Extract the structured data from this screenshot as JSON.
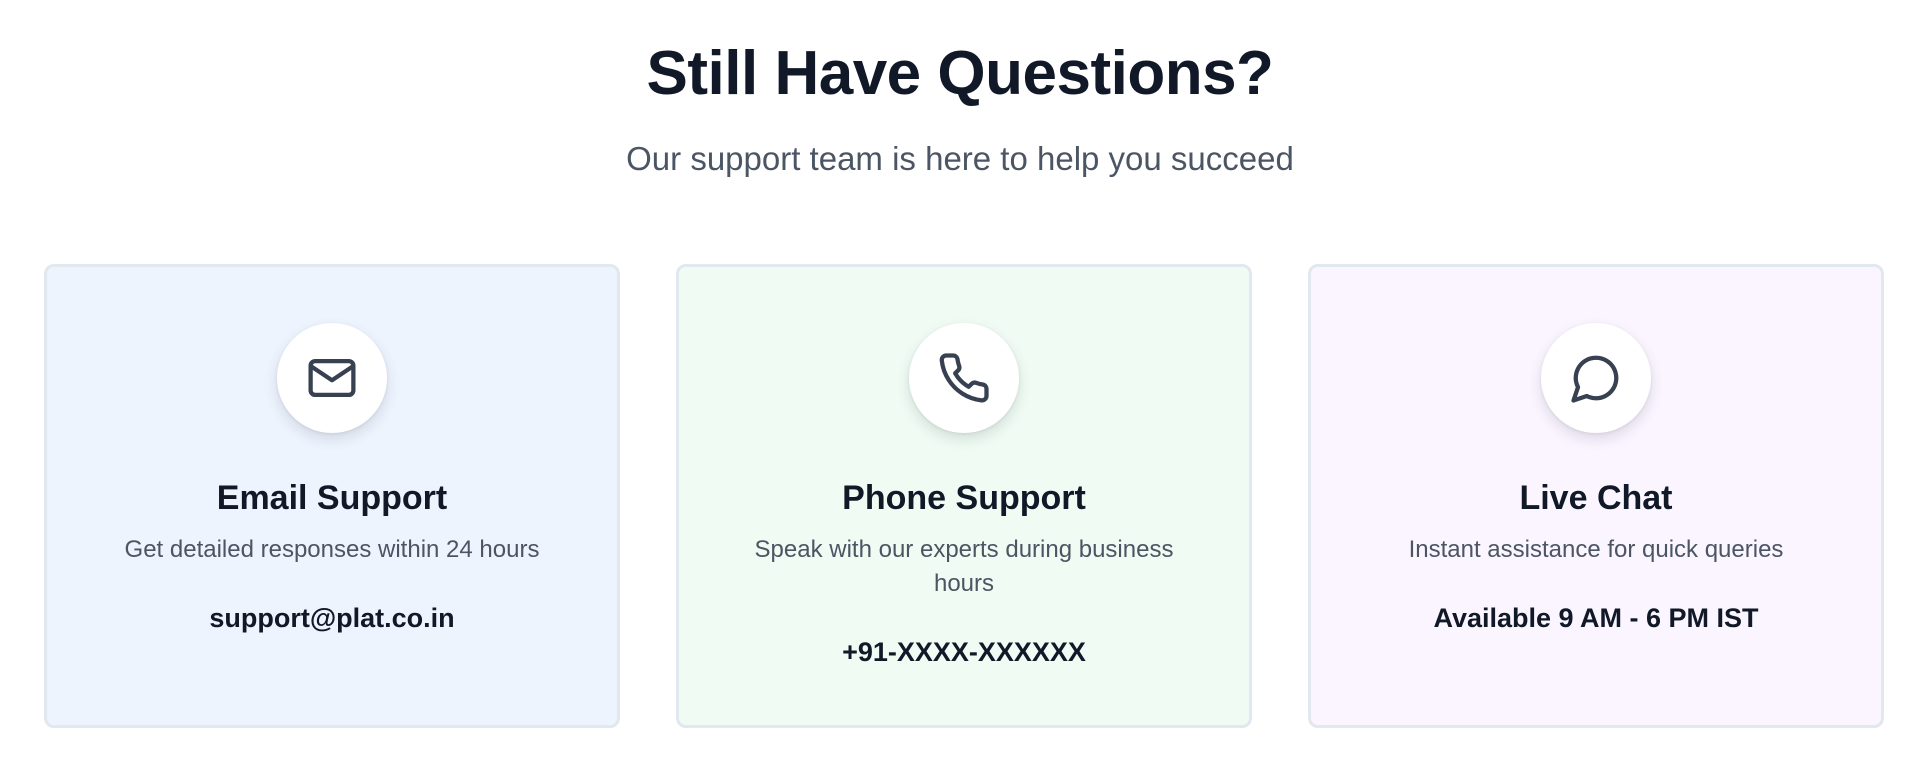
{
  "header": {
    "title": "Still Have Questions?",
    "subtitle": "Our support team is here to help you succeed"
  },
  "cards": [
    {
      "icon": "mail-icon",
      "title": "Email Support",
      "description": "Get detailed responses within 24 hours",
      "contact": "support@plat.co.in",
      "background": "#eef4fe"
    },
    {
      "icon": "phone-icon",
      "title": "Phone Support",
      "description": "Speak with our experts during business hours",
      "contact": "+91-XXXX-XXXXXX",
      "background": "#effbf3"
    },
    {
      "icon": "chat-bubble-icon",
      "title": "Live Chat",
      "description": "Instant assistance for quick queries",
      "contact": "Available 9 AM - 6 PM IST",
      "background": "#faf5ff"
    }
  ],
  "colors": {
    "heading": "#111827",
    "body_text": "#4b5563",
    "card_border": "#e2e8f0",
    "icon_stroke": "#374151"
  }
}
